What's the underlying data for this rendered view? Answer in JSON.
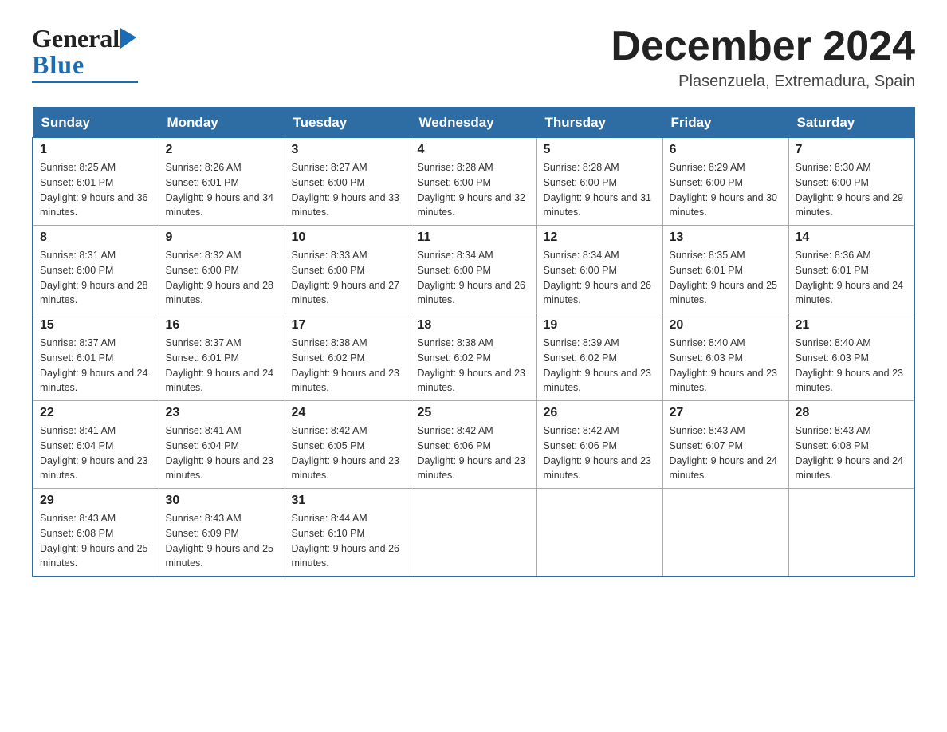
{
  "header": {
    "logo_general": "General",
    "logo_blue": "Blue",
    "title": "December 2024",
    "location": "Plasenzuela, Extremadura, Spain"
  },
  "days_of_week": [
    "Sunday",
    "Monday",
    "Tuesday",
    "Wednesday",
    "Thursday",
    "Friday",
    "Saturday"
  ],
  "weeks": [
    [
      {
        "day": "1",
        "sunrise": "Sunrise: 8:25 AM",
        "sunset": "Sunset: 6:01 PM",
        "daylight": "Daylight: 9 hours and 36 minutes."
      },
      {
        "day": "2",
        "sunrise": "Sunrise: 8:26 AM",
        "sunset": "Sunset: 6:01 PM",
        "daylight": "Daylight: 9 hours and 34 minutes."
      },
      {
        "day": "3",
        "sunrise": "Sunrise: 8:27 AM",
        "sunset": "Sunset: 6:00 PM",
        "daylight": "Daylight: 9 hours and 33 minutes."
      },
      {
        "day": "4",
        "sunrise": "Sunrise: 8:28 AM",
        "sunset": "Sunset: 6:00 PM",
        "daylight": "Daylight: 9 hours and 32 minutes."
      },
      {
        "day": "5",
        "sunrise": "Sunrise: 8:28 AM",
        "sunset": "Sunset: 6:00 PM",
        "daylight": "Daylight: 9 hours and 31 minutes."
      },
      {
        "day": "6",
        "sunrise": "Sunrise: 8:29 AM",
        "sunset": "Sunset: 6:00 PM",
        "daylight": "Daylight: 9 hours and 30 minutes."
      },
      {
        "day": "7",
        "sunrise": "Sunrise: 8:30 AM",
        "sunset": "Sunset: 6:00 PM",
        "daylight": "Daylight: 9 hours and 29 minutes."
      }
    ],
    [
      {
        "day": "8",
        "sunrise": "Sunrise: 8:31 AM",
        "sunset": "Sunset: 6:00 PM",
        "daylight": "Daylight: 9 hours and 28 minutes."
      },
      {
        "day": "9",
        "sunrise": "Sunrise: 8:32 AM",
        "sunset": "Sunset: 6:00 PM",
        "daylight": "Daylight: 9 hours and 28 minutes."
      },
      {
        "day": "10",
        "sunrise": "Sunrise: 8:33 AM",
        "sunset": "Sunset: 6:00 PM",
        "daylight": "Daylight: 9 hours and 27 minutes."
      },
      {
        "day": "11",
        "sunrise": "Sunrise: 8:34 AM",
        "sunset": "Sunset: 6:00 PM",
        "daylight": "Daylight: 9 hours and 26 minutes."
      },
      {
        "day": "12",
        "sunrise": "Sunrise: 8:34 AM",
        "sunset": "Sunset: 6:00 PM",
        "daylight": "Daylight: 9 hours and 26 minutes."
      },
      {
        "day": "13",
        "sunrise": "Sunrise: 8:35 AM",
        "sunset": "Sunset: 6:01 PM",
        "daylight": "Daylight: 9 hours and 25 minutes."
      },
      {
        "day": "14",
        "sunrise": "Sunrise: 8:36 AM",
        "sunset": "Sunset: 6:01 PM",
        "daylight": "Daylight: 9 hours and 24 minutes."
      }
    ],
    [
      {
        "day": "15",
        "sunrise": "Sunrise: 8:37 AM",
        "sunset": "Sunset: 6:01 PM",
        "daylight": "Daylight: 9 hours and 24 minutes."
      },
      {
        "day": "16",
        "sunrise": "Sunrise: 8:37 AM",
        "sunset": "Sunset: 6:01 PM",
        "daylight": "Daylight: 9 hours and 24 minutes."
      },
      {
        "day": "17",
        "sunrise": "Sunrise: 8:38 AM",
        "sunset": "Sunset: 6:02 PM",
        "daylight": "Daylight: 9 hours and 23 minutes."
      },
      {
        "day": "18",
        "sunrise": "Sunrise: 8:38 AM",
        "sunset": "Sunset: 6:02 PM",
        "daylight": "Daylight: 9 hours and 23 minutes."
      },
      {
        "day": "19",
        "sunrise": "Sunrise: 8:39 AM",
        "sunset": "Sunset: 6:02 PM",
        "daylight": "Daylight: 9 hours and 23 minutes."
      },
      {
        "day": "20",
        "sunrise": "Sunrise: 8:40 AM",
        "sunset": "Sunset: 6:03 PM",
        "daylight": "Daylight: 9 hours and 23 minutes."
      },
      {
        "day": "21",
        "sunrise": "Sunrise: 8:40 AM",
        "sunset": "Sunset: 6:03 PM",
        "daylight": "Daylight: 9 hours and 23 minutes."
      }
    ],
    [
      {
        "day": "22",
        "sunrise": "Sunrise: 8:41 AM",
        "sunset": "Sunset: 6:04 PM",
        "daylight": "Daylight: 9 hours and 23 minutes."
      },
      {
        "day": "23",
        "sunrise": "Sunrise: 8:41 AM",
        "sunset": "Sunset: 6:04 PM",
        "daylight": "Daylight: 9 hours and 23 minutes."
      },
      {
        "day": "24",
        "sunrise": "Sunrise: 8:42 AM",
        "sunset": "Sunset: 6:05 PM",
        "daylight": "Daylight: 9 hours and 23 minutes."
      },
      {
        "day": "25",
        "sunrise": "Sunrise: 8:42 AM",
        "sunset": "Sunset: 6:06 PM",
        "daylight": "Daylight: 9 hours and 23 minutes."
      },
      {
        "day": "26",
        "sunrise": "Sunrise: 8:42 AM",
        "sunset": "Sunset: 6:06 PM",
        "daylight": "Daylight: 9 hours and 23 minutes."
      },
      {
        "day": "27",
        "sunrise": "Sunrise: 8:43 AM",
        "sunset": "Sunset: 6:07 PM",
        "daylight": "Daylight: 9 hours and 24 minutes."
      },
      {
        "day": "28",
        "sunrise": "Sunrise: 8:43 AM",
        "sunset": "Sunset: 6:08 PM",
        "daylight": "Daylight: 9 hours and 24 minutes."
      }
    ],
    [
      {
        "day": "29",
        "sunrise": "Sunrise: 8:43 AM",
        "sunset": "Sunset: 6:08 PM",
        "daylight": "Daylight: 9 hours and 25 minutes."
      },
      {
        "day": "30",
        "sunrise": "Sunrise: 8:43 AM",
        "sunset": "Sunset: 6:09 PM",
        "daylight": "Daylight: 9 hours and 25 minutes."
      },
      {
        "day": "31",
        "sunrise": "Sunrise: 8:44 AM",
        "sunset": "Sunset: 6:10 PM",
        "daylight": "Daylight: 9 hours and 26 minutes."
      },
      null,
      null,
      null,
      null
    ]
  ]
}
